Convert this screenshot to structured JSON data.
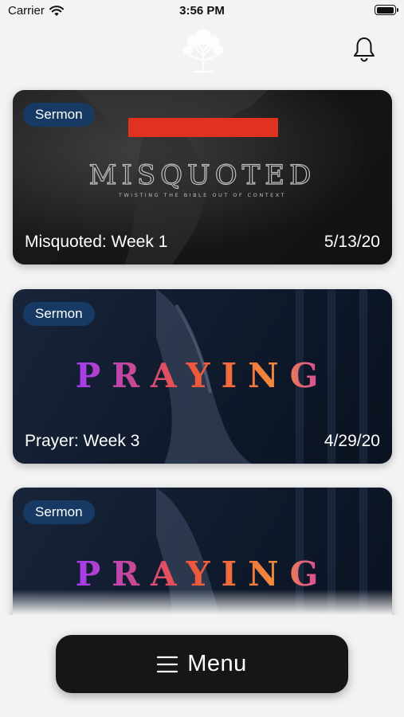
{
  "status_bar": {
    "carrier": "Carrier",
    "time": "3:56 PM"
  },
  "cards": [
    {
      "badge": "Sermon",
      "title": "Misquoted: Week 1",
      "date": "5/13/20",
      "art_title": "MISQUOTED",
      "art_subtitle": "TWISTING THE BIBLE OUT OF CONTEXT"
    },
    {
      "badge": "Sermon",
      "title": "Prayer: Week 3",
      "date": "4/29/20",
      "art_title": "PRAYING"
    },
    {
      "badge": "Sermon",
      "art_title": "PRAYING"
    }
  ],
  "menu": {
    "label": "Menu"
  },
  "icons": {
    "wifi": "wifi-icon",
    "battery": "battery-icon",
    "logo": "tree-logo",
    "bell": "bell-icon",
    "menu": "hamburger-icon"
  },
  "colors": {
    "badge_bg": "#163a63",
    "menu_bg": "#161616",
    "misquoted_bar": "#e0321e",
    "praying_gradient": [
      "#a33cf0",
      "#f0543c",
      "#f08c3c"
    ]
  }
}
